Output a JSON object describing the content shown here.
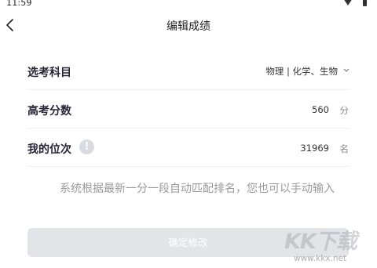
{
  "status_bar": {
    "time": "11:59"
  },
  "nav": {
    "title": "编辑成绩"
  },
  "form": {
    "subjects": {
      "label": "选考科目",
      "value": "物理 | 化学、生物"
    },
    "score": {
      "label": "高考分数",
      "value": "560",
      "unit": "分"
    },
    "rank": {
      "label": "我的位次",
      "info": "!",
      "value": "31969",
      "unit": "名"
    }
  },
  "hint": "系统根据最新一分一段自动匹配排名，您也可以手动输入",
  "confirm_button": {
    "label": "确定修改"
  },
  "watermark": {
    "logo": "KK下载",
    "url": "www.kkx.net"
  }
}
